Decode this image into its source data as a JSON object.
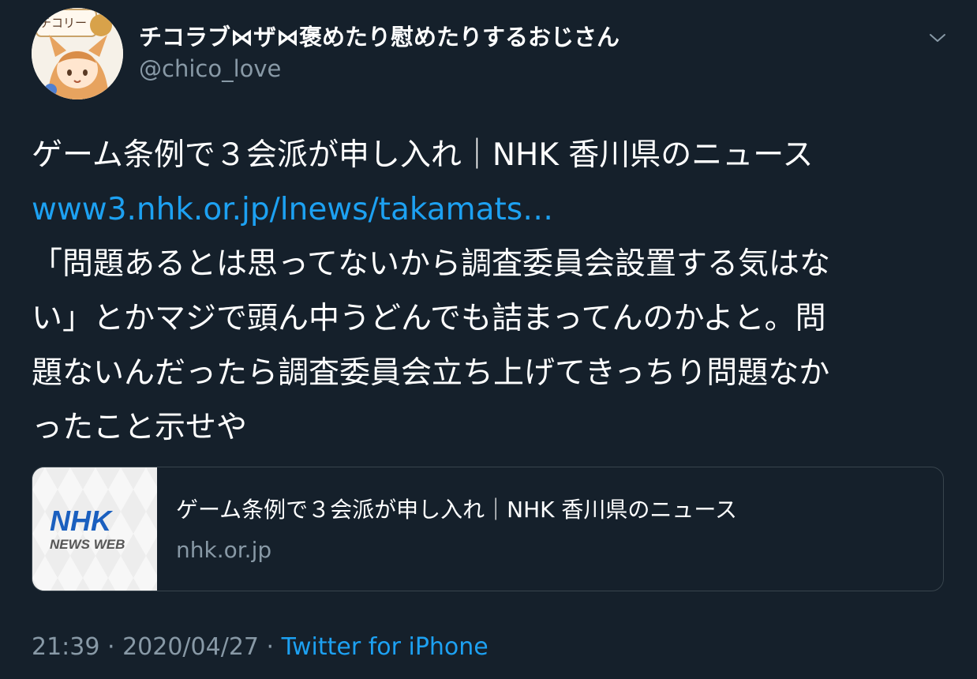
{
  "author": {
    "display_name": "チコラブ⋈ザ⋈褒めたり慰めたりするおじさん",
    "handle": "@chico_love",
    "avatar_text": "チコリー♪ちゃっち"
  },
  "menu": {
    "icon": "chevron-down-icon"
  },
  "tweet": {
    "line1": "ゲーム条例で３会派が申し入れ｜NHK 香川県のニュース",
    "link_text": "www3.nhk.or.jp/lnews/takamats…",
    "line3": "「問題あるとは思ってないから調査委員会設置する気はな",
    "line4": "い」とかマジで頭ん中うどんでも詰まってんのかよと。問",
    "line5": "題ないんだったら調査委員会立ち上げてきっちり問題なか",
    "line6": "ったこと示せや"
  },
  "card": {
    "logo_text": "NHK",
    "logo_subtext": "NEWS WEB",
    "title": "ゲーム条例で３会派が申し入れ｜NHK 香川県のニュース",
    "domain": "nhk.or.jp"
  },
  "footer": {
    "time": "21:39",
    "separator": " · ",
    "date": "2020/04/27",
    "separator2": " · ",
    "source": "Twitter for iPhone"
  },
  "colors": {
    "background": "#15202b",
    "link": "#1da1f2",
    "secondary_text": "#8899a6",
    "nhk_blue": "#1a5fbf"
  }
}
